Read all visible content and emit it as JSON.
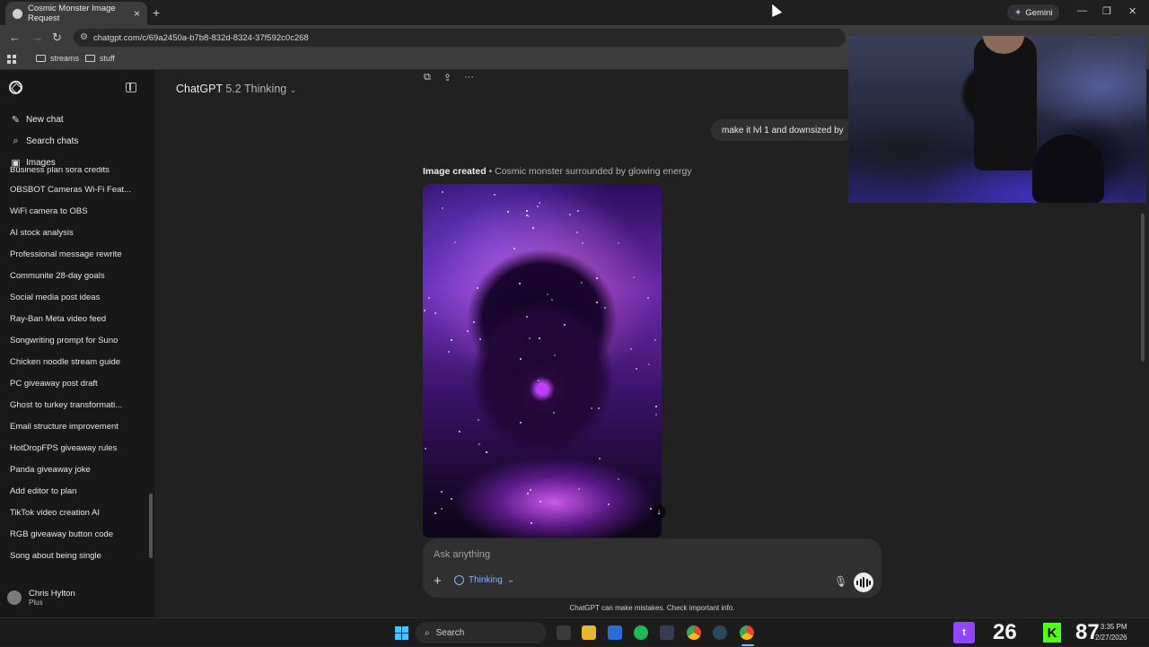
{
  "browser": {
    "tab_title": "Cosmic Monster Image Request",
    "new_tab_symbol": "+",
    "gemini_label": "Gemini",
    "url": "chatgpt.com/c/69a2450a-b7b8-832d-8324-37f592c0c268",
    "bookmarks": [
      "streams",
      "stuff"
    ],
    "window_controls": [
      "—",
      "❐",
      "✕"
    ]
  },
  "sidebar": {
    "top_items": [
      {
        "label": "New chat",
        "icon": "edit-icon"
      },
      {
        "label": "Search chats",
        "icon": "search-icon"
      },
      {
        "label": "Images",
        "icon": "images-icon"
      }
    ],
    "history": [
      "Business plan sora credits",
      "OBSBOT Cameras Wi-Fi Feat...",
      "WiFi camera to OBS",
      "AI stock analysis",
      "Professional message rewrite",
      "Communite 28-day goals",
      "Social media post ideas",
      "Ray-Ban Meta video feed",
      "Songwriting prompt for Suno",
      "Chicken noodle stream guide",
      "PC giveaway post draft",
      "Ghost to turkey transformati...",
      "Email structure improvement",
      "HotDropFPS giveaway rules",
      "Panda giveaway joke",
      "Add editor to plan",
      "TikTok video creation AI",
      "RGB giveaway button code",
      "Song about being single"
    ],
    "user": {
      "name": "Chris Hylton",
      "plan": "Plus"
    }
  },
  "main": {
    "model_name": "ChatGPT",
    "model_version": "5.2 Thinking",
    "user_message": "make it lvl 1 and downsized by",
    "image_caption_bold": "Image created",
    "image_caption_rest": " • Cosmic monster surrounded by glowing energy",
    "composer_placeholder": "Ask anything",
    "thinking_label": "Thinking",
    "disclaimer": "ChatGPT can make mistakes. Check important info."
  },
  "taskbar": {
    "search_label": "Search",
    "twitch_count": "26",
    "kick_count": "87",
    "time": "3:35 PM",
    "date": "2/27/2026"
  },
  "colors": {
    "accent_blue": "#8ab4f8",
    "twitch_purple": "#9146ff",
    "kick_green": "#53fc18",
    "windows_blue": "#4cc2ff"
  }
}
